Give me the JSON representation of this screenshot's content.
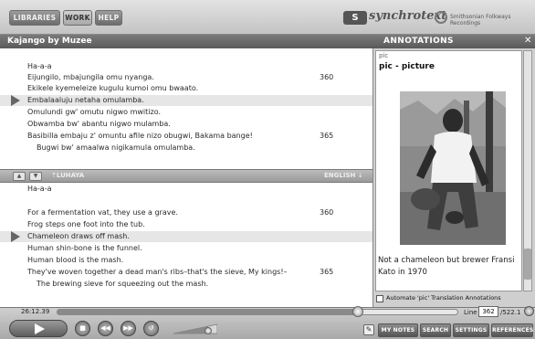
{
  "nav": {
    "libraries": "LIBRARIES",
    "work": "WORK",
    "help": "HELP"
  },
  "brand": {
    "badge": "S",
    "name": "synchrotext",
    "partner": "Smithsonian Folkways Recordings"
  },
  "window": {
    "title": "Kajango by Muzee"
  },
  "original_lines": [
    {
      "text": "Ha-a-a",
      "num": ""
    },
    {
      "text": "Eijungilo, mbajungila omu nyanga.",
      "num": "360"
    },
    {
      "text": "Ekikele kyemeleize kugulu kumoi omu bwaato.",
      "num": ""
    },
    {
      "text": "Embalaaluju netaha omulamba.",
      "num": ""
    },
    {
      "text": "Omulundi gw' omutu nigwo mwitizo.",
      "num": ""
    },
    {
      "text": "Obwamba bw' abantu nigwo mulamba.",
      "num": ""
    },
    {
      "text": "Basibilla embaju z' omuntu afile nizo obugwi, Bakama bange!",
      "num": "365"
    },
    {
      "text": "Bugwi bw' amaalwa nigikamula omulamba.",
      "num": ""
    }
  ],
  "divider": {
    "up": "▲",
    "down": "▼",
    "left_lang": "⇡LUHAYA",
    "right_lang": "ENGLISH ⇣"
  },
  "translation_lines": [
    {
      "text": "Ha-a-a",
      "num": ""
    },
    {
      "text": "",
      "num": ""
    },
    {
      "text": "For a fermentation vat, they use a grave.",
      "num": "360"
    },
    {
      "text": "Frog steps one foot into the tub.",
      "num": ""
    },
    {
      "text": "Chameleon draws off mash.",
      "num": ""
    },
    {
      "text": "Human shin-bone is the funnel.",
      "num": ""
    },
    {
      "text": "Human blood is the mash.",
      "num": ""
    },
    {
      "text": "They've woven together a dead man's ribs–that's the sieve, My kings!–",
      "num": "365"
    },
    {
      "text": "The brewing sieve for squeezing out the mash.",
      "num": ""
    }
  ],
  "annotations": {
    "header": "ANNOTATIONS",
    "close": "✕",
    "tag": "pic",
    "title": "pic - picture",
    "caption": "Not a chameleon but brewer Fransi Kato in 1970",
    "auto_label": "Automate 'pic' Translation Annotations"
  },
  "player": {
    "timecode": "26:12.39",
    "progress": 0.75,
    "line_label": "Line",
    "line_value": "362",
    "line_total": "/522.1",
    "volume": 0.8
  },
  "buttons": {
    "my_notes": "MY NOTES",
    "search": "SEARCH",
    "settings": "SETTINGS",
    "references": "REFERENCES"
  },
  "icons": [
    "play-icon",
    "stop-icon",
    "rewind-icon",
    "fast-forward-icon",
    "loop-icon",
    "pen-icon",
    "close-icon"
  ]
}
